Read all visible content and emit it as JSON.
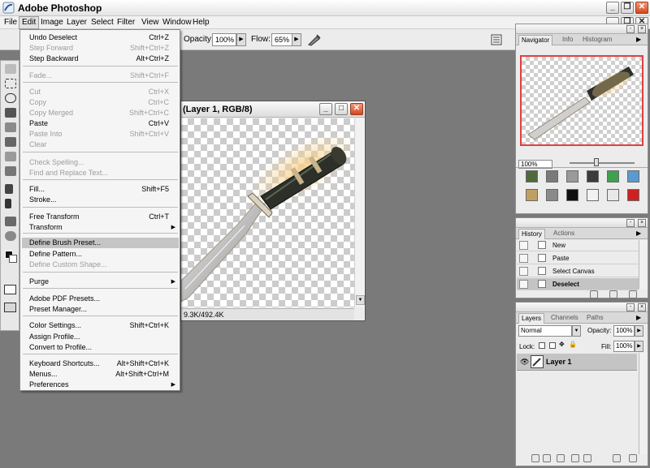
{
  "app": {
    "title": "Adobe Photoshop"
  },
  "menubar": {
    "items": [
      "File",
      "Edit",
      "Image",
      "Layer",
      "Select",
      "Filter",
      "View",
      "Window",
      "Help"
    ]
  },
  "options": {
    "opacity_label": "Opacity:",
    "opacity_value": "100%",
    "flow_label": "Flow:",
    "flow_value": "65%"
  },
  "document": {
    "title": "(Layer 1, RGB/8)",
    "status": "9.3K/492.4K"
  },
  "edit_menu": {
    "items": [
      {
        "label": "Undo Deselect",
        "shortcut": "Ctrl+Z",
        "disabled": false
      },
      {
        "label": "Step Forward",
        "shortcut": "Shift+Ctrl+Z",
        "disabled": true
      },
      {
        "label": "Step Backward",
        "shortcut": "Alt+Ctrl+Z",
        "disabled": false
      },
      {
        "label": "Fade...",
        "shortcut": "Shift+Ctrl+F",
        "disabled": true
      },
      {
        "label": "Cut",
        "shortcut": "Ctrl+X",
        "disabled": true
      },
      {
        "label": "Copy",
        "shortcut": "Ctrl+C",
        "disabled": true
      },
      {
        "label": "Copy Merged",
        "shortcut": "Shift+Ctrl+C",
        "disabled": true
      },
      {
        "label": "Paste",
        "shortcut": "Ctrl+V",
        "disabled": false
      },
      {
        "label": "Paste Into",
        "shortcut": "Shift+Ctrl+V",
        "disabled": true
      },
      {
        "label": "Clear",
        "shortcut": "",
        "disabled": true
      },
      {
        "label": "Check Spelling...",
        "shortcut": "",
        "disabled": true
      },
      {
        "label": "Find and Replace Text...",
        "shortcut": "",
        "disabled": true
      },
      {
        "label": "Fill...",
        "shortcut": "Shift+F5",
        "disabled": false
      },
      {
        "label": "Stroke...",
        "shortcut": "",
        "disabled": false
      },
      {
        "label": "Free Transform",
        "shortcut": "Ctrl+T",
        "disabled": false
      },
      {
        "label": "Transform",
        "shortcut": "",
        "disabled": false,
        "submenu": true
      },
      {
        "label": "Define Brush Preset...",
        "shortcut": "",
        "disabled": false,
        "highlighted": true
      },
      {
        "label": "Define Pattern...",
        "shortcut": "",
        "disabled": false
      },
      {
        "label": "Define Custom Shape...",
        "shortcut": "",
        "disabled": true
      },
      {
        "label": "Purge",
        "shortcut": "",
        "disabled": false,
        "submenu": true
      },
      {
        "label": "Adobe PDF Presets...",
        "shortcut": "",
        "disabled": false
      },
      {
        "label": "Preset Manager...",
        "shortcut": "",
        "disabled": false
      },
      {
        "label": "Color Settings...",
        "shortcut": "Shift+Ctrl+K",
        "disabled": false
      },
      {
        "label": "Assign Profile...",
        "shortcut": "",
        "disabled": false
      },
      {
        "label": "Convert to Profile...",
        "shortcut": "",
        "disabled": false
      },
      {
        "label": "Keyboard Shortcuts...",
        "shortcut": "Alt+Shift+Ctrl+K",
        "disabled": false
      },
      {
        "label": "Menus...",
        "shortcut": "Alt+Shift+Ctrl+M",
        "disabled": false
      },
      {
        "label": "Preferences",
        "shortcut": "",
        "disabled": false,
        "submenu": true
      }
    ]
  },
  "navigator": {
    "tabs": [
      "Navigator",
      "Info",
      "Histogram"
    ],
    "zoom": "100%"
  },
  "history": {
    "tabs": [
      "History",
      "Actions"
    ],
    "rows": [
      "New",
      "Paste",
      "Select Canvas",
      "Deselect"
    ]
  },
  "layers": {
    "tabs": [
      "Layers",
      "Channels",
      "Paths"
    ],
    "blend_mode": "Normal",
    "opacity_label": "Opacity:",
    "opacity_value": "100%",
    "lock_label": "Lock:",
    "fill_label": "Fill:",
    "fill_value": "100%",
    "layer_name": "Layer 1"
  },
  "colors": {
    "swatches": [
      "#4e6a3a",
      "#7a7a7a",
      "#9a9a9a",
      "#3b3b3b",
      "#40a050",
      "#5a9ad0",
      "#c0a060",
      "#8a8a8a",
      "#111111",
      "#f2f2f2",
      "#e8e8e8",
      "#cc2222"
    ]
  }
}
